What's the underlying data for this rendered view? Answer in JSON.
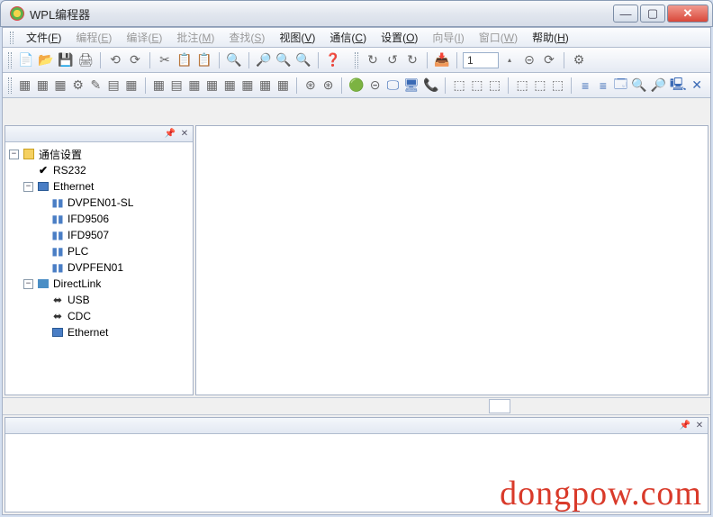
{
  "title": "WPL编程器",
  "win_buttons": {
    "min": "—",
    "max": "▢",
    "close": "✕"
  },
  "menu": [
    {
      "label": "文件",
      "key": "F",
      "enabled": true
    },
    {
      "label": "编程",
      "key": "E",
      "enabled": false
    },
    {
      "label": "编译",
      "key": "E",
      "enabled": false
    },
    {
      "label": "批注",
      "key": "M",
      "enabled": false
    },
    {
      "label": "查找",
      "key": "S",
      "enabled": false
    },
    {
      "label": "视图",
      "key": "V",
      "enabled": true
    },
    {
      "label": "通信",
      "key": "C",
      "enabled": true
    },
    {
      "label": "设置",
      "key": "O",
      "enabled": true
    },
    {
      "label": "向导",
      "key": "I",
      "enabled": false
    },
    {
      "label": "窗口",
      "key": "W",
      "enabled": false
    },
    {
      "label": "帮助",
      "key": "H",
      "enabled": true
    }
  ],
  "toolbar1": {
    "page_value": "1",
    "icons": [
      "📄",
      "📂",
      "💾",
      "🖨",
      "|",
      "⟲",
      "⟳",
      "|",
      "✂",
      "📋",
      "📋",
      "|",
      "🔍",
      "|",
      "🔎",
      "🔍",
      "🔍",
      "|",
      "❓"
    ],
    "icons2": [
      "↻",
      "↺",
      "↻",
      "|",
      "📥",
      "|",
      "⊝",
      "⟳",
      "|",
      "⚙"
    ]
  },
  "toolbar2": {
    "icons": [
      "▦",
      "▦",
      "▦",
      "⚙",
      "✎",
      "▤",
      "▦",
      "|",
      "▦",
      "▤",
      "▦",
      "▦",
      "▦",
      "▦",
      "▦",
      "▦",
      "|",
      "⊛",
      "⊛",
      "|",
      "🟢",
      "⊝",
      "🖵",
      "🖥",
      "📞",
      "|",
      "⬚",
      "⬚",
      "⬚",
      "|",
      "⬚",
      "⬚",
      "⬚",
      "|",
      "≡",
      "≡",
      "🗔",
      "🔍",
      "🔎",
      "🖳",
      "✕"
    ]
  },
  "panel_header": {
    "pin": "📌",
    "close": "✕"
  },
  "tree": {
    "root": "通信设置",
    "children": [
      {
        "label": "RS232",
        "icon": "check"
      },
      {
        "label": "Ethernet",
        "icon": "eth",
        "expanded": true,
        "children": [
          {
            "label": "DVPEN01-SL",
            "icon": "dev"
          },
          {
            "label": "IFD9506",
            "icon": "dev"
          },
          {
            "label": "IFD9507",
            "icon": "dev"
          },
          {
            "label": "PLC",
            "icon": "dev"
          },
          {
            "label": "DVPFEN01",
            "icon": "dev"
          }
        ]
      },
      {
        "label": "DirectLink",
        "icon": "link",
        "expanded": true,
        "children": [
          {
            "label": "USB",
            "icon": "usb"
          },
          {
            "label": "CDC",
            "icon": "usb"
          },
          {
            "label": "Ethernet",
            "icon": "eth2"
          }
        ]
      }
    ]
  },
  "watermark": "dongpow.com"
}
